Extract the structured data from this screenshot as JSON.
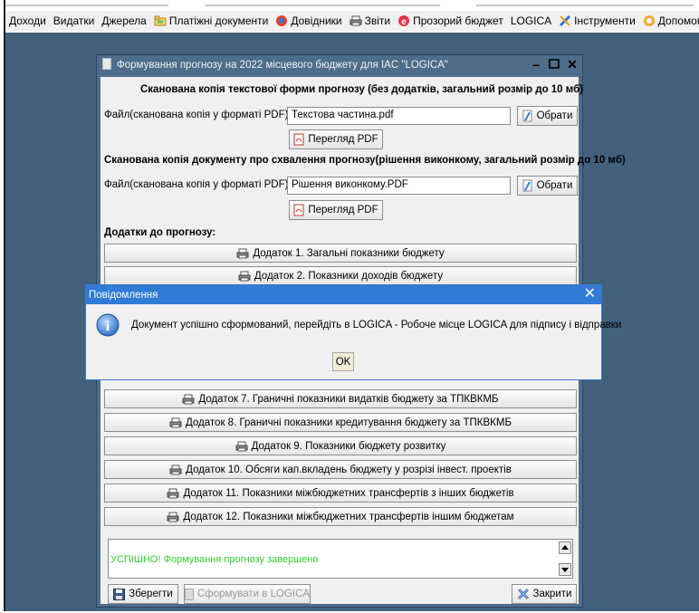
{
  "menubar": {
    "items": [
      {
        "label": "Доходи",
        "icon": ""
      },
      {
        "label": "Видатки",
        "icon": ""
      },
      {
        "label": "Джерела",
        "icon": ""
      },
      {
        "label": "Платіжні документи",
        "icon": "folder-money-icon"
      },
      {
        "label": "Довідники",
        "icon": "globe-icon"
      },
      {
        "label": "Звіти",
        "icon": "printer-icon"
      },
      {
        "label": "Прозорий бюджет",
        "icon": "budget-icon"
      },
      {
        "label": "LOGICA",
        "icon": ""
      },
      {
        "label": "Інструменти",
        "icon": "tools-icon"
      },
      {
        "label": "Допомог",
        "icon": "help-icon"
      }
    ]
  },
  "window": {
    "title": "Формування прогнозу на 2022 місцевого бюджету для IAC \"LOGICA\"",
    "section_text_copy": "Сканована копія текстової форми прогнозу (без додатків, загальний розмір до 10 мб)",
    "file_label": "Файл(сканована копія у форматі PDF)",
    "file1_value": "Текстова частина.pdf",
    "choose_label": "Обрати",
    "view_pdf_label": "Перегляд PDF",
    "section_approval": "Сканована копія документу про схвалення прогнозу(рішення виконкому, загальний розмір до 10 мб)",
    "file2_value": "Рішення виконкому.PDF",
    "appendix_heading": "Додатки до прогнозу:",
    "appendix_buttons": [
      "Додаток 1. Загальні показники бюджету",
      "Додаток 2. Показники доходів бюджету",
      "Додаток 7. Граничні показники видатків бюджету за ТПКВКМБ",
      "Додаток 8. Граничні показники кредитування бюджету за ТПКВКМБ",
      "Додаток 9. Показники бюджету розвитку",
      "Додаток 10. Обсяги кап.вкладень бюджету у розрізі інвест. проектів",
      "Додаток 11. Показники міжбюджетних трансфертів з інших бюджетів",
      "Додаток 12. Показники міжбюджетних трансфертів іншим бюджетам"
    ],
    "status_text": "УСПІШНО! Формування прогнозу завершено",
    "save_label": "Зберегти",
    "form_logica_label": "Сформувати в LOGICA",
    "close_label": "Закрити"
  },
  "dialog": {
    "title": "Повідомлення",
    "message": "Документ успішно сформований, перейдіть в LOGICA - Робоче місце LOGICA для підпису і відправки",
    "ok_label": "OK"
  },
  "colors": {
    "desktop": "#41617d",
    "window_title": "#4d6d8b",
    "dialog_title": "#2f7bd6",
    "success_text": "#2fd12f"
  }
}
